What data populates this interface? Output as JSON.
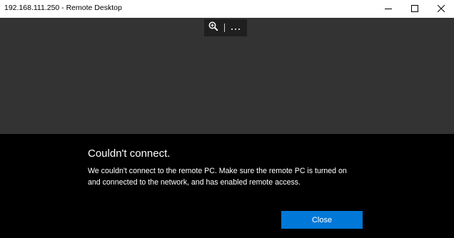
{
  "window": {
    "title": "192.168.111.250 - Remote Desktop",
    "controls": {
      "minimize_icon": "minimize-icon",
      "maximize_icon": "maximize-icon",
      "close_icon": "close-icon"
    }
  },
  "toolbar": {
    "zoom_icon": "zoom-in-icon",
    "more_icon": "more-icon"
  },
  "dialog": {
    "title": "Couldn't connect.",
    "message": "We couldn't connect to the remote PC. Make sure the remote PC is turned on and connected to the network, and has enabled remote access.",
    "close_label": "Close"
  },
  "colors": {
    "accent": "#0078d7",
    "session_background": "#333333",
    "dialog_background": "#000000",
    "titlebar_background": "#ffffff"
  }
}
